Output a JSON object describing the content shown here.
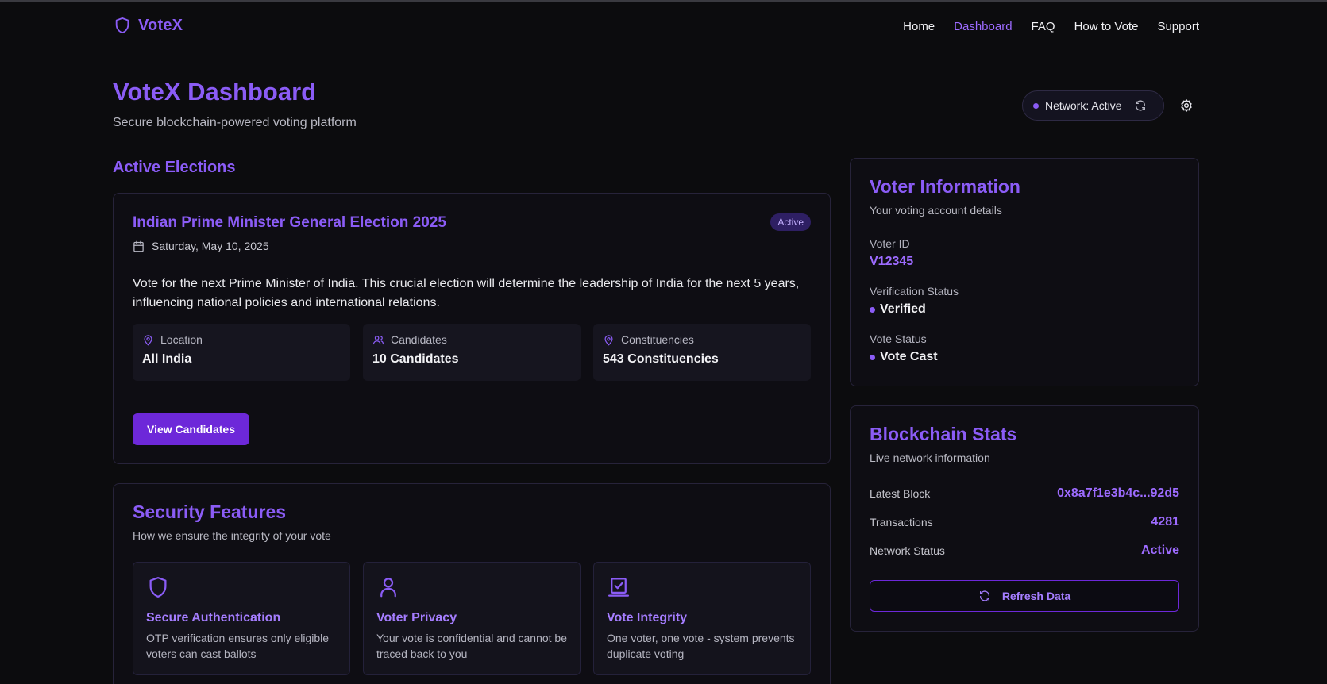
{
  "nav": {
    "brand": "VoteX",
    "links": [
      {
        "label": "Home",
        "active": false
      },
      {
        "label": "Dashboard",
        "active": true
      },
      {
        "label": "FAQ",
        "active": false
      },
      {
        "label": "How to Vote",
        "active": false
      },
      {
        "label": "Support",
        "active": false
      }
    ]
  },
  "header": {
    "title": "VoteX Dashboard",
    "subtitle": "Secure blockchain-powered voting platform",
    "network_pill": "Network: Active",
    "icons": [
      "refresh-icon",
      "gear-icon"
    ]
  },
  "elections": {
    "section_title": "Active Elections",
    "card": {
      "title": "Indian Prime Minister General Election 2025",
      "badge": "Active",
      "date": "Saturday, May 10, 2025",
      "description": "Vote for the next Prime Minister of India. This crucial election will determine the leadership of India for the next 5 years, influencing national policies and international relations.",
      "stats": [
        {
          "icon": "map-pin-icon",
          "label": "Location",
          "value": "All India"
        },
        {
          "icon": "users-icon",
          "label": "Candidates",
          "value": "10 Candidates"
        },
        {
          "icon": "map-pin-icon",
          "label": "Constituencies",
          "value": "543 Constituencies"
        }
      ],
      "button": "View Candidates"
    }
  },
  "security": {
    "title": "Security Features",
    "subtitle": "How we ensure the integrity of your vote",
    "features": [
      {
        "icon": "shield-icon",
        "title": "Secure Authentication",
        "desc": "OTP verification ensures only eligible voters can cast ballots"
      },
      {
        "icon": "user-icon",
        "title": "Voter Privacy",
        "desc": "Your vote is confidential and cannot be traced back to you"
      },
      {
        "icon": "ballot-check-icon",
        "title": "Vote Integrity",
        "desc": "One voter, one vote - system prevents duplicate voting"
      }
    ]
  },
  "voter": {
    "title": "Voter Information",
    "subtitle": "Your voting account details",
    "id_label": "Voter ID",
    "id_value": "V12345",
    "verification_label": "Verification Status",
    "verification_value": "Verified",
    "vote_status_label": "Vote Status",
    "vote_status_value": "Vote Cast"
  },
  "blockchain": {
    "title": "Blockchain Stats",
    "subtitle": "Live network information",
    "rows": [
      {
        "label": "Latest Block",
        "value": "0x8a7f1e3b4c...92d5"
      },
      {
        "label": "Transactions",
        "value": "4281"
      },
      {
        "label": "Network Status",
        "value": "Active"
      }
    ],
    "button": "Refresh Data"
  },
  "colors": {
    "accent": "#8b5cf6",
    "button": "#6d28d9",
    "background": "#0c0c0e"
  }
}
